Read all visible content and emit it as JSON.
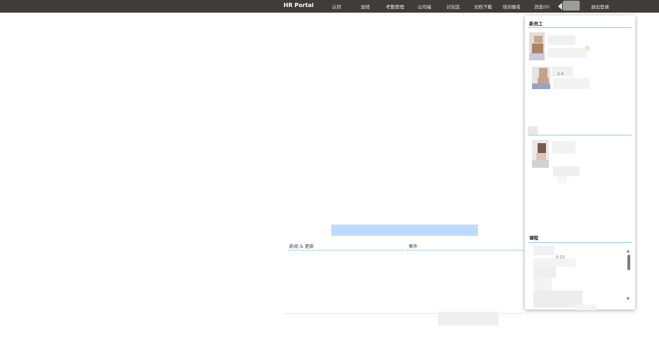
{
  "header": {
    "brand": "HR Portal",
    "nav": [
      "认同",
      "加班",
      "考勤管理",
      "公司福",
      "讨论区",
      "文档下载",
      "培训报名",
      "消息(0)",
      "退出登录"
    ]
  },
  "main": {
    "news_title": "新闻 & 更新",
    "events_title": "事件"
  },
  "panel": {
    "new_employees_title": "新员工",
    "birthday_title": "",
    "courses_title": "课程",
    "entry_date_1": "2-4",
    "date_2": "5-13"
  }
}
